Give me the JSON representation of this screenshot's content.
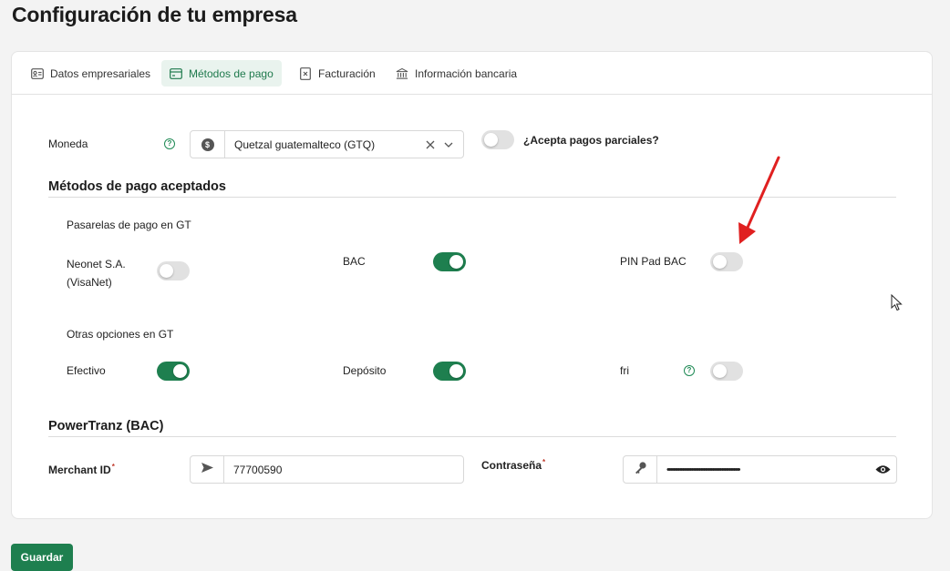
{
  "page_title": "Configuración de tu empresa",
  "tabs": [
    {
      "label": "Datos empresariales",
      "icon": "id-card-icon",
      "active": false
    },
    {
      "label": "Métodos de pago",
      "icon": "credit-card-icon",
      "active": true
    },
    {
      "label": "Facturación",
      "icon": "invoice-icon",
      "active": false
    },
    {
      "label": "Información bancaria",
      "icon": "bank-icon",
      "active": false
    }
  ],
  "currency": {
    "label": "Moneda",
    "value": "Quetzal guatemalteco (GTQ)",
    "partial_payments_label": "¿Acepta pagos parciales?",
    "partial_payments_enabled": false
  },
  "payment_methods": {
    "title": "Métodos de pago aceptados",
    "gateways_title": "Pasarelas de pago en GT",
    "gateways": [
      {
        "label_line1": "Neonet S.A.",
        "label_line2": "(VisaNet)",
        "enabled": false
      },
      {
        "label": "BAC",
        "enabled": true
      },
      {
        "label": "PIN Pad BAC",
        "enabled": false
      }
    ],
    "others_title": "Otras opciones en GT",
    "others": [
      {
        "label": "Efectivo",
        "enabled": true
      },
      {
        "label": "Depósito",
        "enabled": true
      },
      {
        "label": "fri",
        "enabled": false
      }
    ]
  },
  "powertranz": {
    "title": "PowerTranz (BAC)",
    "merchant_label": "Merchant ID",
    "merchant_value": "77700590",
    "password_label": "Contraseña",
    "password_value": "••••••••••••••••••••••••••••••••••••••••••••••••"
  },
  "save_label": "Guardar",
  "colors": {
    "accent": "#1e7f4f",
    "annotation_arrow": "#e02020"
  }
}
